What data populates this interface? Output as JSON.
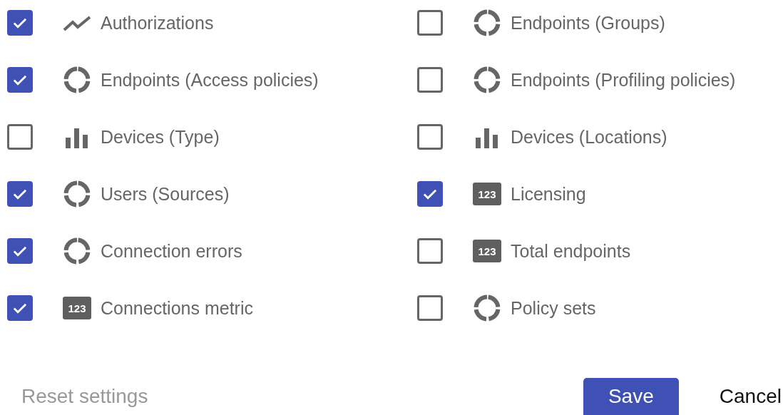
{
  "columns": [
    [
      {
        "label": "Authorizations",
        "kind": "line",
        "checked": true
      },
      {
        "label": "Endpoints (Access policies)",
        "kind": "donut",
        "checked": true
      },
      {
        "label": "Devices (Type)",
        "kind": "bar",
        "checked": false
      },
      {
        "label": "Users (Sources)",
        "kind": "donut",
        "checked": true
      },
      {
        "label": "Connection errors",
        "kind": "donut",
        "checked": true
      },
      {
        "label": "Connections metric",
        "kind": "number",
        "badge": "123",
        "checked": true
      }
    ],
    [
      {
        "label": "Endpoints (Groups)",
        "kind": "donut",
        "checked": false
      },
      {
        "label": "Endpoints (Profiling policies)",
        "kind": "donut",
        "checked": false
      },
      {
        "label": "Devices (Locations)",
        "kind": "bar",
        "checked": false
      },
      {
        "label": "Licensing",
        "kind": "number",
        "badge": "123",
        "checked": true
      },
      {
        "label": "Total endpoints",
        "kind": "number",
        "badge": "123",
        "checked": false
      },
      {
        "label": "Policy sets",
        "kind": "donut",
        "checked": false
      }
    ]
  ],
  "reset": "Reset settings",
  "save": "Save",
  "cancel": "Cancel"
}
